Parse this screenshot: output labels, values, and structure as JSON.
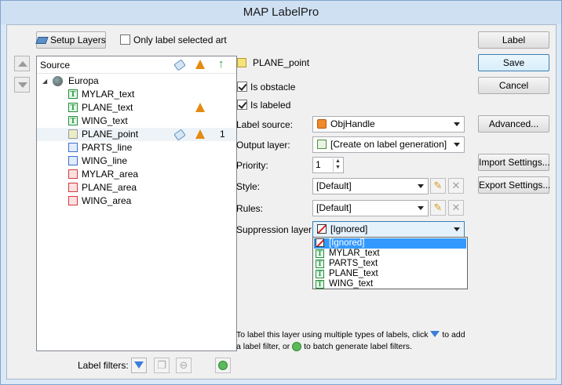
{
  "window": {
    "title": "MAP LabelPro"
  },
  "toolbar": {
    "setup_layers_label": "Setup Layers",
    "only_selected_label": "Only label selected art",
    "only_selected_checked": false
  },
  "tree": {
    "header_source": "Source",
    "root": "Europa",
    "items": [
      {
        "name": "MYLAR_text",
        "kind": "text",
        "cone": false,
        "tag": false,
        "priority": ""
      },
      {
        "name": "PLANE_text",
        "kind": "text",
        "cone": true,
        "tag": false,
        "priority": ""
      },
      {
        "name": "WING_text",
        "kind": "text",
        "cone": false,
        "tag": false,
        "priority": ""
      },
      {
        "name": "PLANE_point",
        "kind": "point",
        "cone": true,
        "tag": true,
        "priority": "1"
      },
      {
        "name": "PARTS_line",
        "kind": "line",
        "cone": false,
        "tag": false,
        "priority": ""
      },
      {
        "name": "WING_line",
        "kind": "line",
        "cone": false,
        "tag": false,
        "priority": ""
      },
      {
        "name": "MYLAR_area",
        "kind": "area",
        "cone": false,
        "tag": false,
        "priority": ""
      },
      {
        "name": "PLANE_area",
        "kind": "area",
        "cone": false,
        "tag": false,
        "priority": ""
      },
      {
        "name": "WING_area",
        "kind": "area",
        "cone": false,
        "tag": false,
        "priority": ""
      }
    ]
  },
  "details": {
    "layer_name": "PLANE_point",
    "is_obstacle_label": "Is obstacle",
    "is_obstacle_checked": true,
    "is_labeled_label": "Is labeled",
    "is_labeled_checked": true,
    "label_source_label": "Label source:",
    "label_source_value": "ObjHandle",
    "output_layer_label": "Output layer:",
    "output_layer_value": "[Create on label generation]",
    "priority_label": "Priority:",
    "priority_value": "1",
    "style_label": "Style:",
    "style_value": "[Default]",
    "rules_label": "Rules:",
    "rules_value": "[Default]",
    "suppression_label": "Suppression layer:",
    "suppression_value": "[Ignored]",
    "suppression_options": [
      "[Ignored]",
      "MYLAR_text",
      "PARTS_text",
      "PLANE_text",
      "WING_text"
    ],
    "suppression_highlighted": "[Ignored]"
  },
  "help": {
    "line1_a": "To label this layer using multiple types of labels, click",
    "line1_b": "to add",
    "line2_a": "a label filter, or",
    "line2_b": "to batch generate label filters."
  },
  "bottom": {
    "label_filters_label": "Label filters:"
  },
  "right_buttons": {
    "label": "Label",
    "save": "Save",
    "cancel": "Cancel",
    "advanced": "Advanced...",
    "import": "Import Settings...",
    "export": "Export Settings..."
  },
  "colors": {
    "accent": "#3399ff",
    "cone": "#e58a12",
    "text_icon": "#1f8f3a",
    "line_icon": "#3b6fd1",
    "area_icon": "#d43a3a"
  }
}
